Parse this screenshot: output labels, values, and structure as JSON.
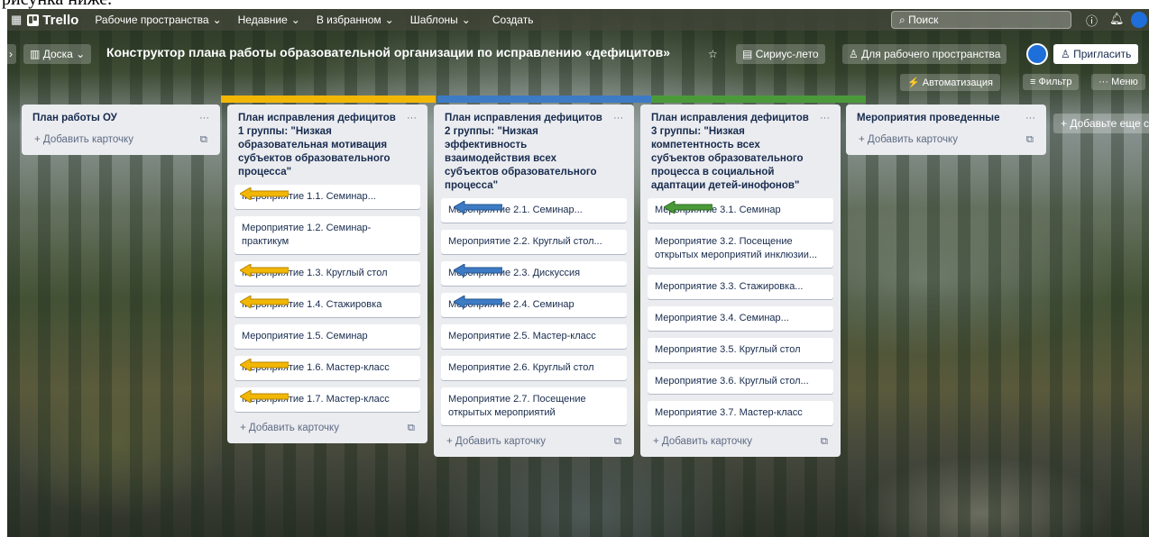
{
  "cut_text": "рисунка ниже.",
  "nav": {
    "logo": "Trello",
    "workspaces": "Рабочие пространства",
    "recent": "Недавние",
    "starred": "В избранном",
    "templates": "Шаблоны",
    "create": "Создать",
    "search_placeholder": "Поиск"
  },
  "board": {
    "view": "Доска",
    "title": "Конструктор плана работы образовательной организации по исправлению «дефицитов»",
    "workspace": "Сириус-лето",
    "visibility": "Для рабочего пространства",
    "invite": "Пригласить",
    "automation": "Автоматизация",
    "filter": "Фильтр",
    "menu": "Меню",
    "add_list": "Добавьте еще список"
  },
  "stripe_colors": {
    "yellow": "#f2b705",
    "blue": "#3d7bc4",
    "green": "#4b9a3a"
  },
  "lists": [
    {
      "title": "План работы ОУ",
      "cards": [],
      "add": "Добавить карточку"
    },
    {
      "title": "План исправления дефицитов 1 группы: \"Низкая образовательная мотивация субъектов образовательного процесса\"",
      "cards": [
        "Мероприятие 1.1. Семинар...",
        "Мероприятие 1.2. Семинар-практикум",
        "Мероприятие 1.3. Круглый стол",
        "Мероприятие 1.4. Стажировка",
        "Мероприятие 1.5. Семинар",
        "Мероприятие 1.6. Мастер-класс",
        "Мероприятие 1.7. Мастер-класс"
      ],
      "add": "Добавить карточку"
    },
    {
      "title": "План исправления дефицитов 2 группы: \"Низкая эффективность взаимодействия всех субъектов образовательного процесса\"",
      "cards": [
        "Мероприятие 2.1. Семинар...",
        "Мероприятие 2.2. Круглый стол...",
        "Мероприятие 2.3. Дискуссия",
        "Мероприятие 2.4. Семинар",
        "Мероприятие 2.5. Мастер-класс",
        "Мероприятие 2.6. Круглый стол",
        "Мероприятие 2.7. Посещение открытых мероприятий"
      ],
      "add": "Добавить карточку"
    },
    {
      "title": "План исправления дефицитов 3 группы: \"Низкая компетентность всех субъектов образовательного процесса в социальной адаптации детей-инофонов\"",
      "cards": [
        "Мероприятие 3.1. Семинар",
        "Мероприятие 3.2. Посещение открытых мероприятий инклюзии...",
        "Мероприятие 3.3. Стажировка...",
        "Мероприятие 3.4. Семинар...",
        "Мероприятие 3.5. Круглый стол",
        "Мероприятие 3.6. Круглый стол...",
        "Мероприятие 3.7. Мастер-класс"
      ],
      "add": "Добавить карточку"
    },
    {
      "title": "Мероприятия проведенные",
      "cards": [],
      "add": "Добавить карточку"
    }
  ]
}
